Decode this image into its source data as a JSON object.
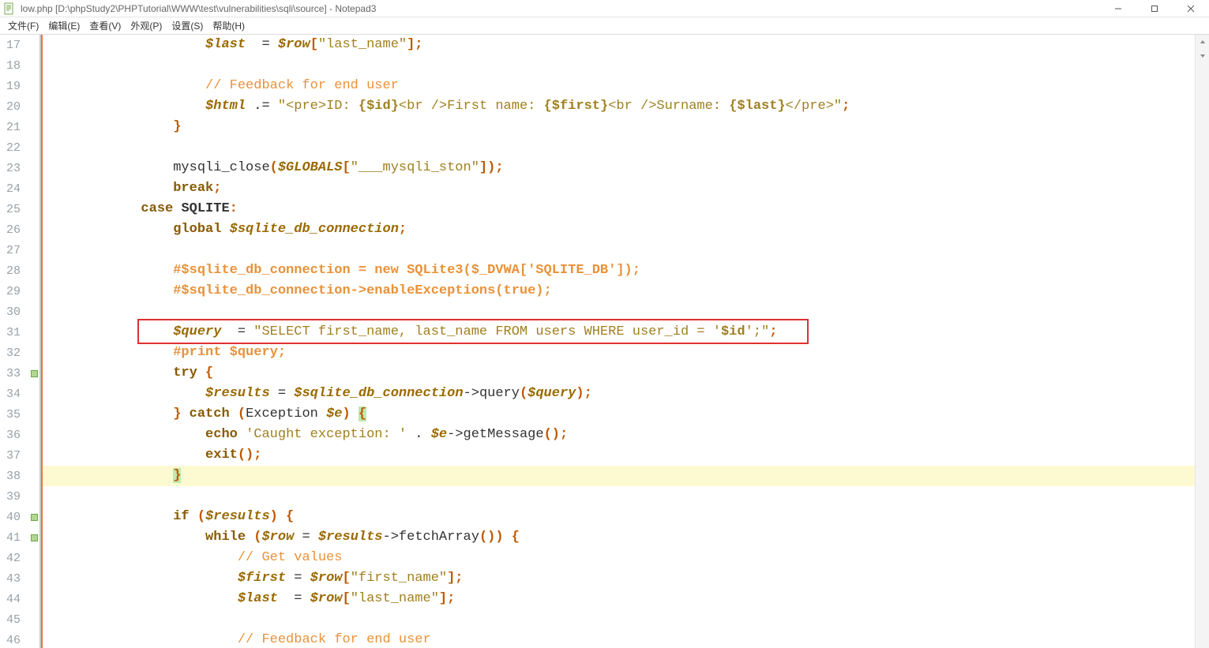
{
  "window": {
    "title": "low.php [D:\\phpStudy2\\PHPTutorial\\WWW\\test\\vulnerabilities\\sqli\\source] - Notepad3"
  },
  "menu": {
    "file": "文件(F)",
    "edit": "编辑(E)",
    "view": "查看(V)",
    "appearance": "外观(P)",
    "settings": "设置(S)",
    "help": "帮助(H)"
  },
  "gutter": {
    "start": 17,
    "end": 46,
    "fold_marks": [
      33,
      40,
      41
    ]
  },
  "highlight": {
    "line": 38,
    "red_box_line": 31
  },
  "code": {
    "17": {
      "indent": "                    ",
      "tokens": [
        [
          "var",
          "$last"
        ],
        [
          "op",
          "  = "
        ],
        [
          "var",
          "$row"
        ],
        [
          "pun",
          "["
        ],
        [
          "str",
          "\"last_name\""
        ],
        [
          "pun",
          "];"
        ]
      ]
    },
    "18": {
      "indent": "",
      "tokens": []
    },
    "19": {
      "indent": "                    ",
      "tokens": [
        [
          "cmt",
          "// Feedback for end user"
        ]
      ]
    },
    "20": {
      "indent": "                    ",
      "tokens": [
        [
          "var",
          "$html"
        ],
        [
          "op",
          " .= "
        ],
        [
          "str",
          "\"<pre>ID: "
        ],
        [
          "varstr",
          "{$id}"
        ],
        [
          "str",
          "<br />First name: "
        ],
        [
          "varstr",
          "{$first}"
        ],
        [
          "str",
          "<br />Surname: "
        ],
        [
          "varstr",
          "{$last}"
        ],
        [
          "str",
          "</pre>\""
        ],
        [
          "pun",
          ";"
        ]
      ]
    },
    "21": {
      "indent": "                ",
      "tokens": [
        [
          "pun",
          "}"
        ]
      ]
    },
    "22": {
      "indent": "",
      "tokens": []
    },
    "23": {
      "indent": "                ",
      "tokens": [
        [
          "id",
          "mysqli_close"
        ],
        [
          "pun",
          "("
        ],
        [
          "var",
          "$GLOBALS"
        ],
        [
          "pun",
          "["
        ],
        [
          "str",
          "\"___mysqli_ston\""
        ],
        [
          "pun",
          "]);"
        ]
      ]
    },
    "24": {
      "indent": "                ",
      "tokens": [
        [
          "kw",
          "break"
        ],
        [
          "pun",
          ";"
        ]
      ]
    },
    "25": {
      "indent": "            ",
      "tokens": [
        [
          "kw",
          "case"
        ],
        [
          "op",
          " "
        ],
        [
          "const",
          "SQLITE"
        ],
        [
          "pun",
          ":"
        ]
      ]
    },
    "26": {
      "indent": "                ",
      "tokens": [
        [
          "kw",
          "global"
        ],
        [
          "op",
          " "
        ],
        [
          "var",
          "$sqlite_db_connection"
        ],
        [
          "pun",
          ";"
        ]
      ]
    },
    "27": {
      "indent": "",
      "tokens": []
    },
    "28": {
      "indent": "                ",
      "tokens": [
        [
          "cmt2",
          "#$sqlite_db_connection = new SQLite3($_DVWA['SQLITE_DB']);"
        ]
      ]
    },
    "29": {
      "indent": "                ",
      "tokens": [
        [
          "cmt2",
          "#$sqlite_db_connection->enableExceptions(true);"
        ]
      ]
    },
    "30": {
      "indent": "",
      "tokens": []
    },
    "31": {
      "indent": "                ",
      "tokens": [
        [
          "var",
          "$query"
        ],
        [
          "op",
          "  = "
        ],
        [
          "str",
          "\"SELECT first_name, last_name FROM users WHERE user_id = '"
        ],
        [
          "varstr",
          "$id"
        ],
        [
          "str",
          "';\""
        ],
        [
          "pun",
          ";"
        ]
      ]
    },
    "32": {
      "indent": "                ",
      "tokens": [
        [
          "cmt2",
          "#print $query;"
        ]
      ]
    },
    "33": {
      "indent": "                ",
      "tokens": [
        [
          "kw",
          "try"
        ],
        [
          "op",
          " "
        ],
        [
          "pun",
          "{"
        ]
      ]
    },
    "34": {
      "indent": "                    ",
      "tokens": [
        [
          "var",
          "$results"
        ],
        [
          "op",
          " = "
        ],
        [
          "var",
          "$sqlite_db_connection"
        ],
        [
          "op",
          "->"
        ],
        [
          "id",
          "query"
        ],
        [
          "pun",
          "("
        ],
        [
          "var",
          "$query"
        ],
        [
          "pun",
          ");"
        ]
      ]
    },
    "35": {
      "indent": "                ",
      "tokens": [
        [
          "pun",
          "}"
        ],
        [
          "op",
          " "
        ],
        [
          "kw",
          "catch"
        ],
        [
          "op",
          " "
        ],
        [
          "pun",
          "("
        ],
        [
          "id",
          "Exception "
        ],
        [
          "var",
          "$e"
        ],
        [
          "pun",
          ")"
        ],
        [
          "op",
          " "
        ],
        [
          "punhl",
          "{"
        ]
      ]
    },
    "36": {
      "indent": "                    ",
      "tokens": [
        [
          "kw",
          "echo"
        ],
        [
          "op",
          " "
        ],
        [
          "str",
          "'Caught exception: '"
        ],
        [
          "op",
          " . "
        ],
        [
          "var",
          "$e"
        ],
        [
          "op",
          "->"
        ],
        [
          "id",
          "getMessage"
        ],
        [
          "pun",
          "();"
        ]
      ]
    },
    "37": {
      "indent": "                    ",
      "tokens": [
        [
          "kw",
          "exit"
        ],
        [
          "pun",
          "();"
        ]
      ]
    },
    "38": {
      "indent": "                ",
      "tokens": [
        [
          "punhl",
          "}"
        ]
      ]
    },
    "39": {
      "indent": "",
      "tokens": []
    },
    "40": {
      "indent": "                ",
      "tokens": [
        [
          "kw",
          "if"
        ],
        [
          "op",
          " "
        ],
        [
          "pun",
          "("
        ],
        [
          "var",
          "$results"
        ],
        [
          "pun",
          ")"
        ],
        [
          "op",
          " "
        ],
        [
          "pun",
          "{"
        ]
      ]
    },
    "41": {
      "indent": "                    ",
      "tokens": [
        [
          "kw",
          "while"
        ],
        [
          "op",
          " "
        ],
        [
          "pun",
          "("
        ],
        [
          "var",
          "$row"
        ],
        [
          "op",
          " = "
        ],
        [
          "var",
          "$results"
        ],
        [
          "op",
          "->"
        ],
        [
          "id",
          "fetchArray"
        ],
        [
          "pun",
          "())"
        ],
        [
          "op",
          " "
        ],
        [
          "pun",
          "{"
        ]
      ]
    },
    "42": {
      "indent": "                        ",
      "tokens": [
        [
          "cmt",
          "// Get values"
        ]
      ]
    },
    "43": {
      "indent": "                        ",
      "tokens": [
        [
          "var",
          "$first"
        ],
        [
          "op",
          " = "
        ],
        [
          "var",
          "$row"
        ],
        [
          "pun",
          "["
        ],
        [
          "str",
          "\"first_name\""
        ],
        [
          "pun",
          "];"
        ]
      ]
    },
    "44": {
      "indent": "                        ",
      "tokens": [
        [
          "var",
          "$last"
        ],
        [
          "op",
          "  = "
        ],
        [
          "var",
          "$row"
        ],
        [
          "pun",
          "["
        ],
        [
          "str",
          "\"last_name\""
        ],
        [
          "pun",
          "];"
        ]
      ]
    },
    "45": {
      "indent": "",
      "tokens": []
    },
    "46": {
      "indent": "                        ",
      "tokens": [
        [
          "cmt",
          "// Feedback for end user"
        ]
      ]
    }
  }
}
